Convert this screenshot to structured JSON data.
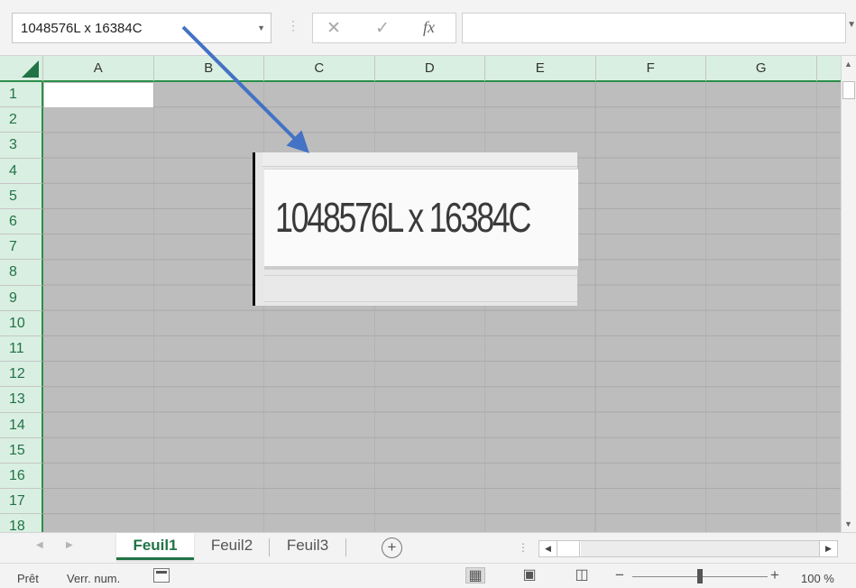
{
  "formula_bar": {
    "name_box": "1048576L x 16384C",
    "name_box_dropdown_icon": "chevron-down-icon",
    "cancel_symbol": "✕",
    "enter_symbol": "✓",
    "fx_label": "fx",
    "formula_value": ""
  },
  "columns": [
    "A",
    "B",
    "C",
    "D",
    "E",
    "F",
    "G"
  ],
  "rows": [
    "1",
    "2",
    "3",
    "4",
    "5",
    "6",
    "7",
    "8",
    "9",
    "10",
    "11",
    "12",
    "13",
    "14",
    "15",
    "16",
    "17",
    "18"
  ],
  "callout": {
    "text": "1048576L x 16384C"
  },
  "sheet_tabs": {
    "tabs": [
      "Feuil1",
      "Feuil2",
      "Feuil3"
    ],
    "active": "Feuil1",
    "add_symbol": "+"
  },
  "status_bar": {
    "ready": "Prêt",
    "num_lock": "Verr. num.",
    "zoom_level": "100 %",
    "zoom_minus": "−",
    "zoom_plus": "+"
  },
  "colors": {
    "accent": "#217346",
    "header_bg": "#d9efe1",
    "selection_bg": "#bdbdbd",
    "arrow": "#4472c4"
  }
}
